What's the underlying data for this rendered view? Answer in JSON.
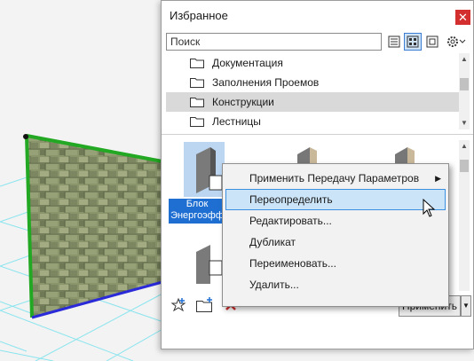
{
  "panel": {
    "title": "Избранное",
    "close_glyph": "✕",
    "search": {
      "placeholder": "Поиск",
      "value": ""
    },
    "toolbar": {
      "list_view": "list-view-icon",
      "thumb_view": "thumbnail-view-icon",
      "preview_view": "preview-view-icon",
      "settings": "gear-icon"
    },
    "tree": [
      {
        "label": "Документация",
        "selected": false
      },
      {
        "label": "Заполнения Проемов",
        "selected": false
      },
      {
        "label": "Конструкции",
        "selected": true
      },
      {
        "label": "Лестницы",
        "selected": false
      }
    ],
    "items": [
      {
        "label_line1": "Блок",
        "label_line2": "Энергоэфф"
      },
      {
        "label": ""
      },
      {
        "label": ""
      },
      {
        "label": ""
      }
    ],
    "bottom": {
      "apply_label": "Применить",
      "add_favorite": "star-add-icon",
      "new_folder": "folder-add-icon",
      "delete": "delete-x-icon"
    }
  },
  "context_menu": [
    {
      "label": "Применить Передачу Параметров",
      "submenu": true
    },
    {
      "label": "Переопределить",
      "highlighted": true
    },
    {
      "label": "Редактировать..."
    },
    {
      "label": "Дубликат"
    },
    {
      "label": "Переименовать..."
    },
    {
      "label": "Удалить..."
    }
  ],
  "colors": {
    "accent": "#1f6fd2",
    "highlight_border": "#3b8fe0",
    "close": "#d32f2f",
    "wall_edge": "#22a822"
  }
}
